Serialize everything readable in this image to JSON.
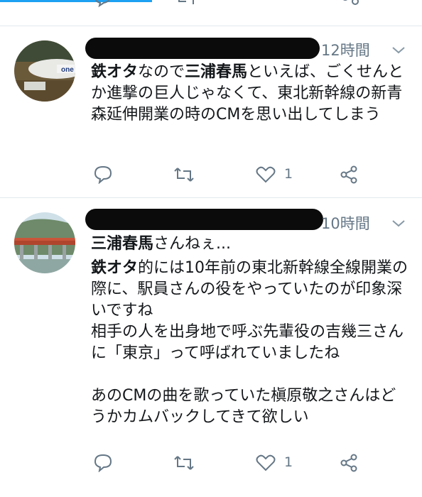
{
  "colors": {
    "accent": "#1da1f2",
    "muted": "#657786",
    "text": "#14171a",
    "divider": "#e1e8ed"
  },
  "tweets": [
    {
      "time": "12時間",
      "body_bold1": "鉄オタ",
      "body_text1": "なので",
      "body_bold2": "三浦春馬",
      "body_text2": "といえば、ごくせんとか進撃の巨人じゃなくて、東北新幹線の新青森延伸開業の時のCMを思い出してしまう",
      "like_count": "1",
      "icons": [
        "reply-icon",
        "retweet-icon",
        "heart-icon",
        "share-icon"
      ]
    },
    {
      "time": "10時間",
      "display_name": "三浦春馬",
      "name_suffix": "さんねぇ...",
      "body_bold1": "鉄オタ",
      "body_text1": "的には10年前の東北新幹線全線開業の際に、駅員さんの役をやっていたのが印象深いですね\n相手の人を出身地で呼ぶ先輩役の吉幾三さんに「東京」って呼ばれていましたね\n\nあのCMの曲を歌っていた槇原敬之さんはどうかカムバックしてきて欲しい",
      "like_count": "1",
      "icons": [
        "reply-icon",
        "retweet-icon",
        "heart-icon",
        "share-icon"
      ]
    }
  ]
}
